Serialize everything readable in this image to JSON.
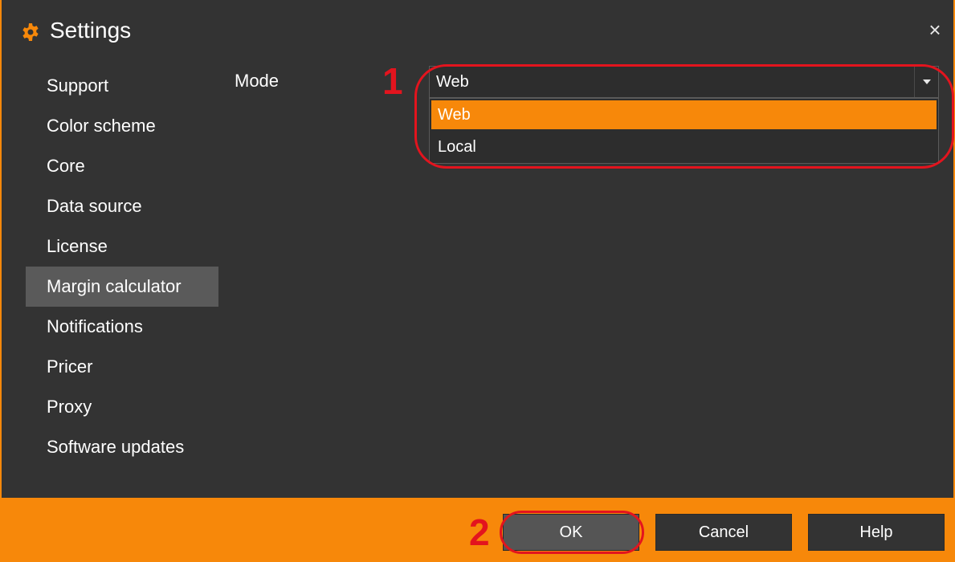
{
  "window": {
    "title": "Settings",
    "close_glyph": "×",
    "icon": "gear-icon"
  },
  "sidebar": {
    "items": [
      {
        "label": "Support"
      },
      {
        "label": "Color scheme"
      },
      {
        "label": "Core"
      },
      {
        "label": "Data source"
      },
      {
        "label": "License"
      },
      {
        "label": "Margin calculator",
        "selected": true
      },
      {
        "label": "Notifications"
      },
      {
        "label": "Pricer"
      },
      {
        "label": "Proxy"
      },
      {
        "label": "Software updates"
      }
    ]
  },
  "main": {
    "mode_label": "Mode",
    "mode_select": {
      "value": "Web",
      "options": [
        "Web",
        "Local"
      ],
      "highlighted": "Web"
    }
  },
  "footer": {
    "ok_label": "OK",
    "cancel_label": "Cancel",
    "help_label": "Help"
  },
  "annotations": {
    "step1": "1",
    "step2": "2",
    "color": "#e3141e"
  },
  "colors": {
    "accent": "#f7880a",
    "background": "#333333",
    "selected_item": "#5a5a5a"
  }
}
